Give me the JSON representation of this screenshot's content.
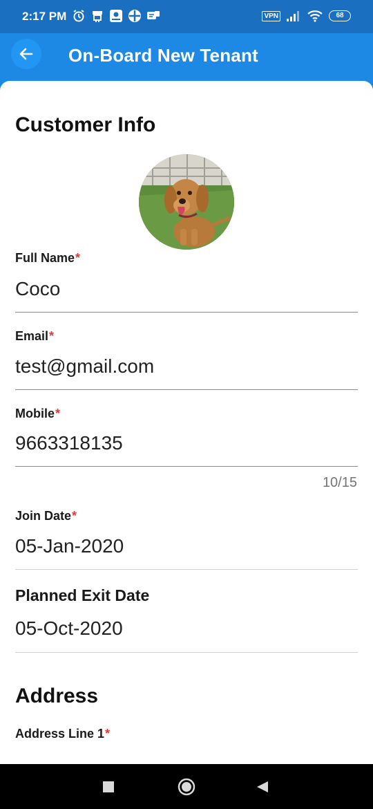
{
  "status": {
    "time": "2:17 PM",
    "vpn": "VPN",
    "battery": "68"
  },
  "app_bar": {
    "title": "On-Board New Tenant",
    "back_icon": "arrow-left-icon"
  },
  "form": {
    "customer_section_title": "Customer Info",
    "fields": {
      "full_name": {
        "label": "Full Name",
        "required": "*",
        "value": "Coco"
      },
      "email": {
        "label": "Email",
        "required": "*",
        "value": "test@gmail.com"
      },
      "mobile": {
        "label": "Mobile",
        "required": "*",
        "value": "9663318135",
        "counter": "10/15"
      },
      "join_date": {
        "label": "Join Date",
        "required": "*",
        "value": "05-Jan-2020"
      },
      "planned_exit_date": {
        "label": "Planned Exit Date",
        "value": "05-Oct-2020"
      },
      "address_line_1": {
        "label": "Address Line 1",
        "required": "*"
      }
    },
    "address_section_title": "Address"
  },
  "colors": {
    "primary": "#1e88e5",
    "status_bar": "#1a6fc0",
    "required_asterisk": "#e53935"
  }
}
